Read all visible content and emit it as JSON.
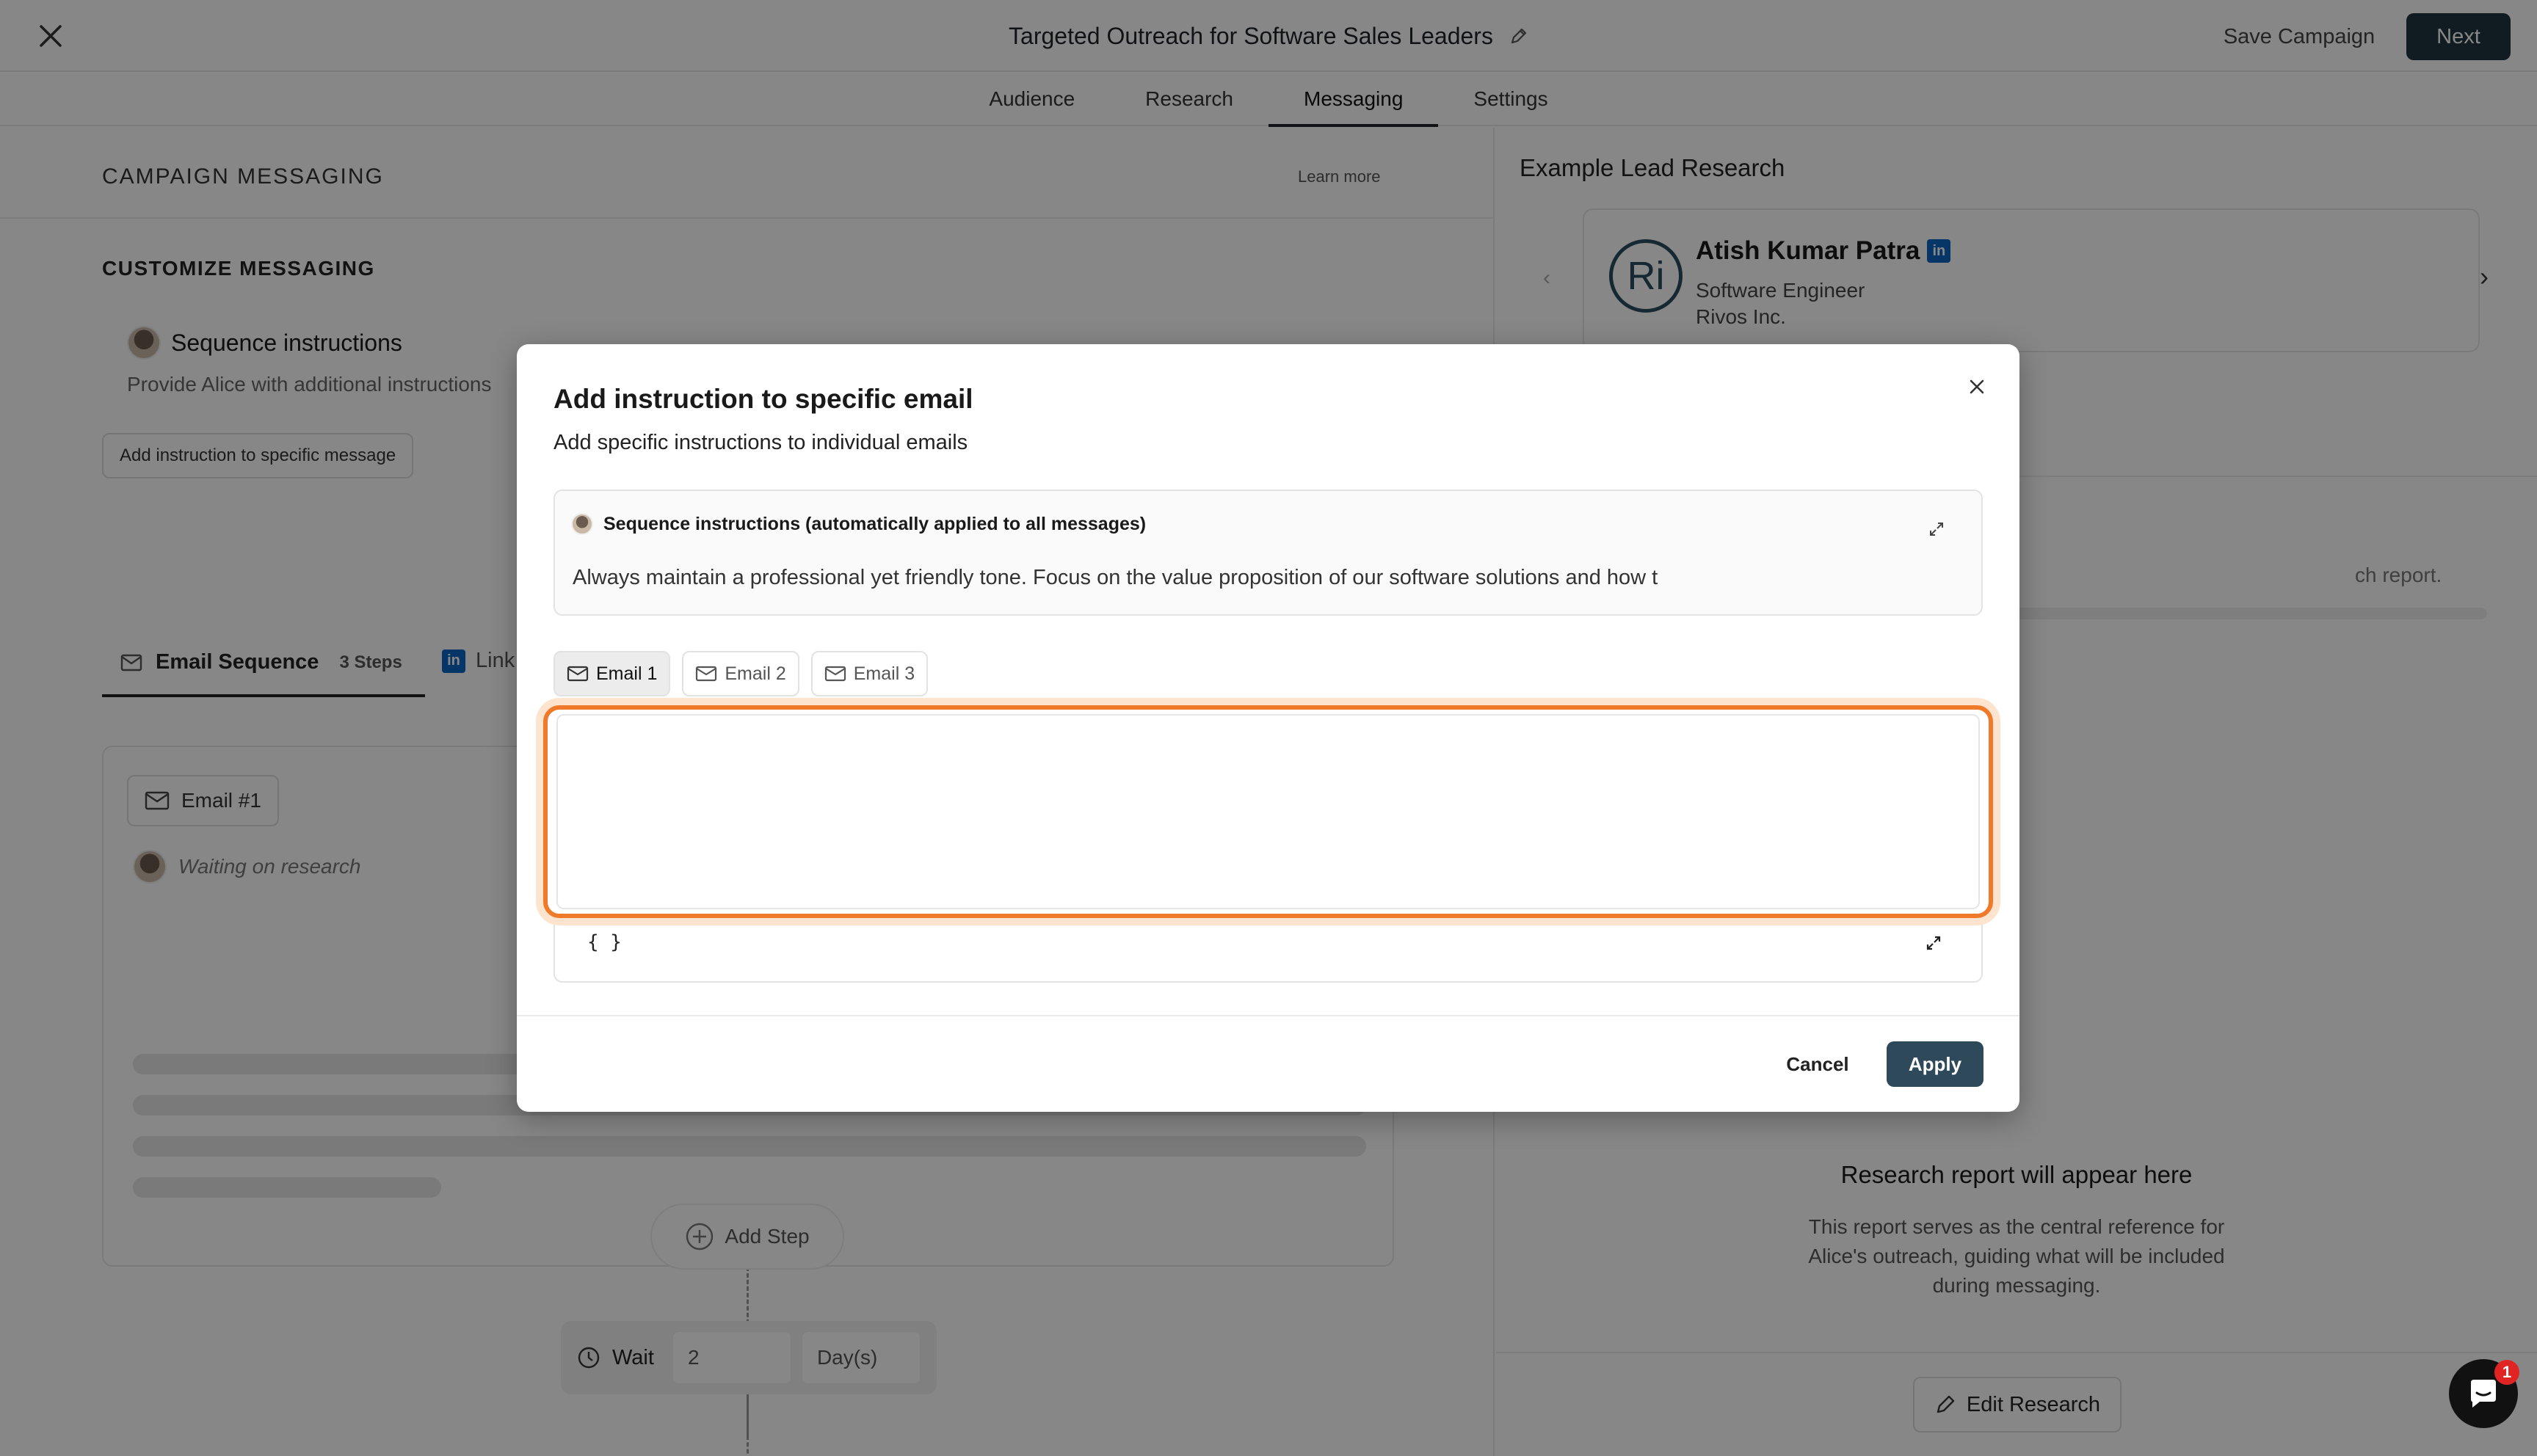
{
  "header": {
    "title": "Targeted Outreach for Software Sales Leaders",
    "save_label": "Save Campaign",
    "next_label": "Next"
  },
  "tabs": [
    {
      "label": "Audience"
    },
    {
      "label": "Research"
    },
    {
      "label": "Messaging",
      "active": true
    },
    {
      "label": "Settings"
    }
  ],
  "left": {
    "section_title": "CAMPAIGN MESSAGING",
    "learn_more": "Learn more",
    "customize_title": "CUSTOMIZE MESSAGING",
    "seq_card_title": "Sequence instructions",
    "seq_card_desc": "Provide Alice with additional instructions",
    "add_instruction_btn": "Add instruction to specific message",
    "email_seq_tab": "Email Sequence",
    "email_seq_steps": "3 Steps",
    "linkedin_tab": "Link",
    "email1_label": "Email #1",
    "waiting": "Waiting on research",
    "add_step": "Add Step",
    "wait_label": "Wait",
    "wait_value": "2",
    "wait_unit": "Day(s)"
  },
  "right": {
    "section_title": "Example Lead Research",
    "lead": {
      "initials": "Ri",
      "name": "Atish Kumar Patra",
      "role": "Software Engineer",
      "company": "Rivos Inc."
    },
    "partial_text": "ch report.",
    "report_title": "Research report will appear here",
    "report_desc": "This report serves as the central reference for Alice's outreach, guiding what will be included during messaging.",
    "edit_research": "Edit Research"
  },
  "modal": {
    "title": "Add instruction to specific email",
    "subtitle": "Add specific instructions to individual emails",
    "seq_title": "Sequence instructions (automatically applied to all messages)",
    "seq_body": "Always maintain a professional yet friendly tone. Focus on the value proposition of our software solutions and how t",
    "email_tabs": [
      {
        "label": "Email 1",
        "active": true
      },
      {
        "label": "Email 2"
      },
      {
        "label": "Email 3"
      }
    ],
    "editor_value": "",
    "braces": "{ }",
    "cancel": "Cancel",
    "apply": "Apply"
  },
  "chat": {
    "badge": "1"
  },
  "colors": {
    "primary": "#1f3440",
    "apply": "#2e4a5a",
    "focus_ring": "#ee7a2a",
    "linkedin": "#0a66c2",
    "badge": "#e02424"
  }
}
